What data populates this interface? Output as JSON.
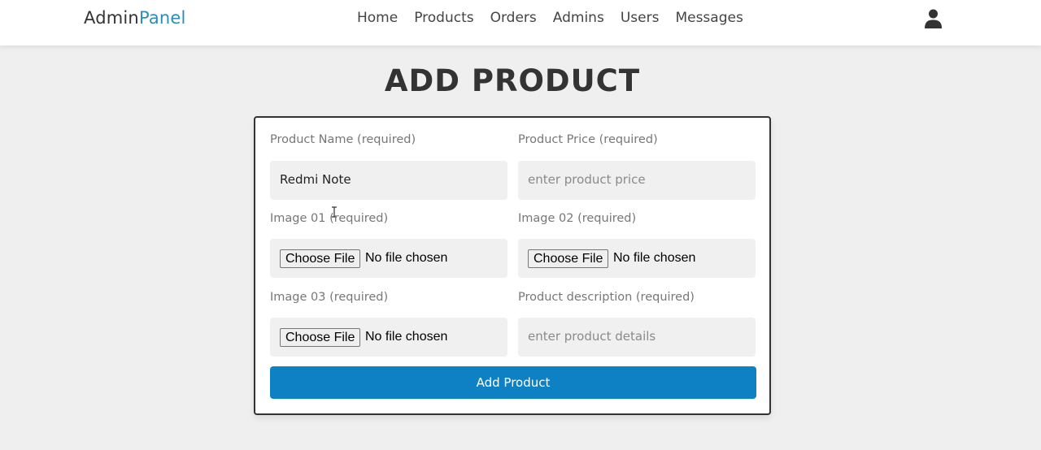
{
  "header": {
    "logo_main": "Admin",
    "logo_accent": "Panel",
    "nav": [
      "Home",
      "Products",
      "Orders",
      "Admins",
      "Users",
      "Messages"
    ],
    "user_icon": "user-icon"
  },
  "page": {
    "title": "ADD PRODUCT"
  },
  "form": {
    "name_label": "Product Name (required)",
    "name_value": "Redmi Note",
    "price_label": "Product Price (required)",
    "price_placeholder": "enter product price",
    "image1_label": "Image 01 (required)",
    "image2_label": "Image 02 (required)",
    "image3_label": "Image 03 (required)",
    "desc_label": "Product description (required)",
    "desc_placeholder": "enter product details",
    "choose_file": "Choose File",
    "no_file": "No file chosen",
    "submit_label": "Add Product"
  },
  "colors": {
    "accent": "#2a8fb6",
    "button": "#0e81c4",
    "background": "#efefef"
  }
}
